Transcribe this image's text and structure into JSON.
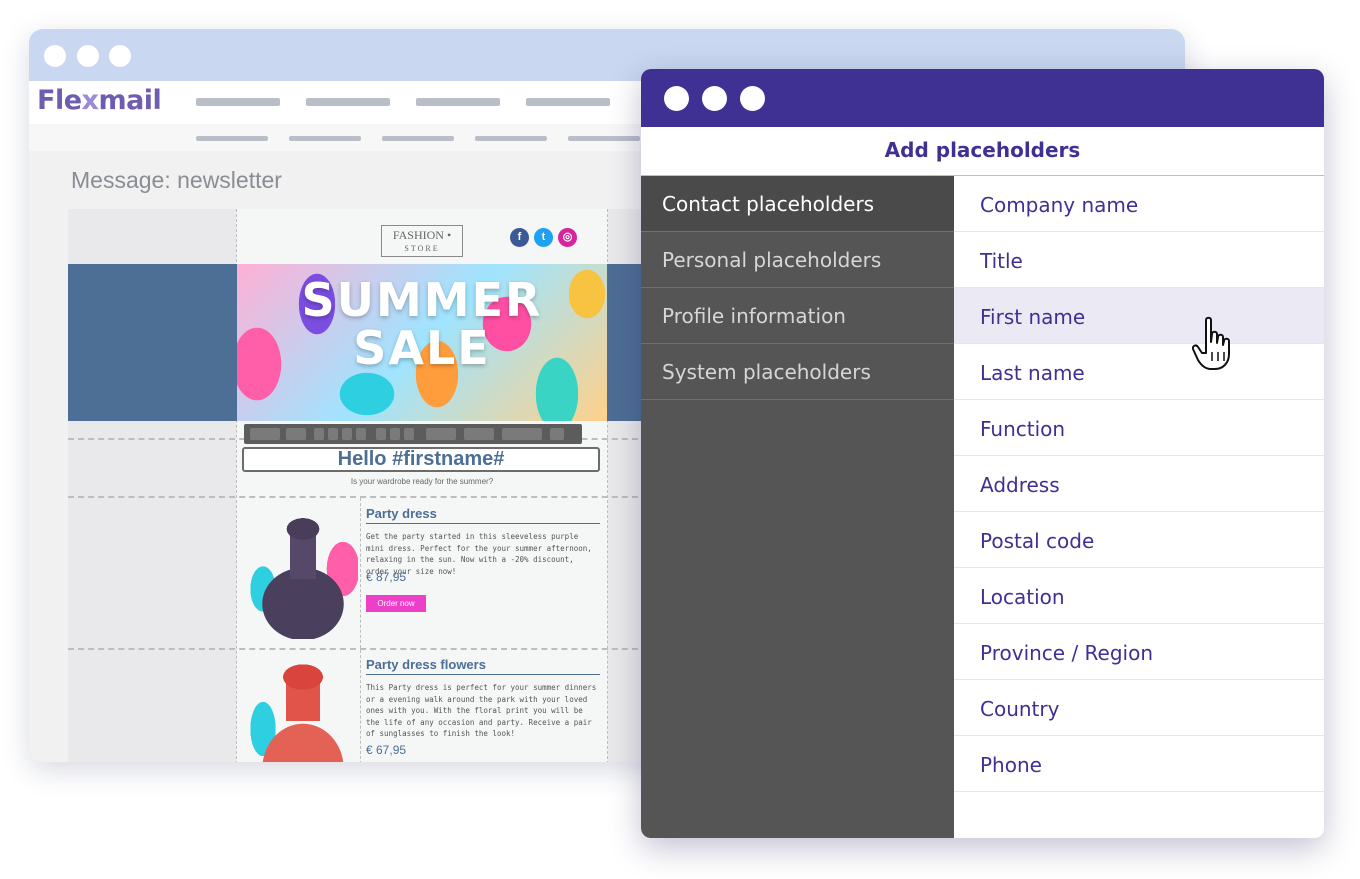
{
  "back_window": {
    "logo": {
      "pre": "Fle",
      "x": "x",
      "post": "mail"
    },
    "message_title": "Message: newsletter",
    "email": {
      "brand_logo": {
        "line1": "FASHION •",
        "line2": "STORE"
      },
      "social": [
        {
          "icon": "facebook-icon",
          "glyph": "f",
          "color": "#3b5998"
        },
        {
          "icon": "twitter-icon",
          "glyph": "t",
          "color": "#1da1f2"
        },
        {
          "icon": "instagram-icon",
          "glyph": "◎",
          "color": "#d6249f"
        }
      ],
      "hero_line1": "SUMMER",
      "hero_line2": "SALE",
      "greeting": "Hello #firstname#",
      "subheading": "Is your wardrobe ready for the summer?",
      "products": [
        {
          "title": "Party dress",
          "description": "Get the party started in this sleeveless purple mini dress. Perfect for the your summer afternoon, relaxing in the sun. Now with a -20% discount, order your size now!",
          "price": "€ 87,95",
          "button": "Order now"
        },
        {
          "title": "Party dress flowers",
          "description": "This Party dress is perfect for your summer dinners or a evening walk around the park with your loved ones with you. With the floral print you will be the life of any occasion and party. Receive a pair of sunglasses to finish the look!",
          "price": "€ 67,95"
        }
      ]
    }
  },
  "dialog": {
    "title": "Add placeholders",
    "categories": [
      {
        "label": "Contact placeholders",
        "active": true
      },
      {
        "label": "Personal placeholders"
      },
      {
        "label": "Profile information"
      },
      {
        "label": "System placeholders"
      }
    ],
    "items": [
      {
        "label": "Company name"
      },
      {
        "label": "Title"
      },
      {
        "label": "First name",
        "hover": true
      },
      {
        "label": "Last name"
      },
      {
        "label": "Function"
      },
      {
        "label": "Address"
      },
      {
        "label": "Postal code"
      },
      {
        "label": "Location"
      },
      {
        "label": "Province / Region"
      },
      {
        "label": "Country"
      },
      {
        "label": "Phone"
      }
    ]
  },
  "colors": {
    "brand_purple": "#3f3193",
    "hero_band": "#4d6e95",
    "cta_pink": "#ee3fc8",
    "category_panel": "#555555"
  }
}
